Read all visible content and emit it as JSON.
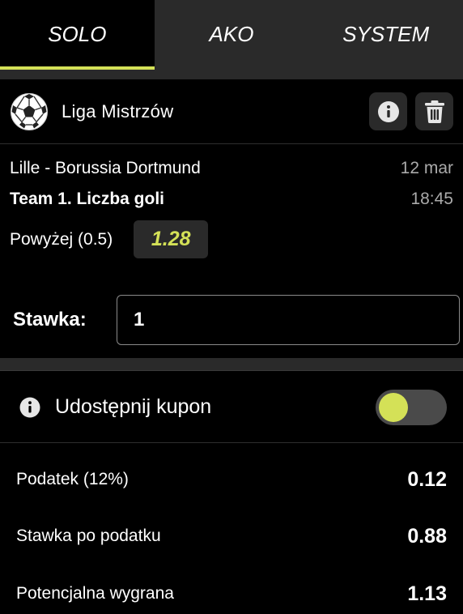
{
  "tabs": [
    {
      "label": "SOLO",
      "active": true
    },
    {
      "label": "AKO",
      "active": false
    },
    {
      "label": "SYSTEM",
      "active": false
    }
  ],
  "league": {
    "icon": "soccer-ball-icon",
    "name": "Liga Mistrzów",
    "actions": [
      "info-icon",
      "trash-icon"
    ]
  },
  "match": {
    "teams": "Lille - Borussia Dortmund",
    "date": "12 mar",
    "market": "Team 1. Liczba goli",
    "time": "18:45",
    "selection": "Powyżej (0.5)",
    "odds": "1.28"
  },
  "stake": {
    "label": "Stawka:",
    "value": "1"
  },
  "share": {
    "label": "Udostępnij kupon",
    "enabled": false
  },
  "summary": [
    {
      "label": "Podatek (12%)",
      "value": "0.12"
    },
    {
      "label": "Stawka po podatku",
      "value": "0.88"
    },
    {
      "label": "Potencjalna wygrana",
      "value": "1.13"
    }
  ],
  "colors": {
    "accent": "#d4e157",
    "background": "#000000",
    "panel": "#2a2a2a"
  }
}
